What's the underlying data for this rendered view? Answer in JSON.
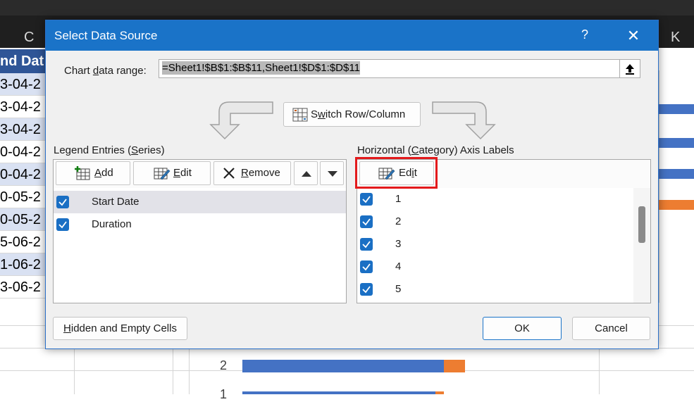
{
  "background": {
    "column_letters": [
      "C",
      "K"
    ],
    "column_header": "nd Dat",
    "column_cells": [
      "3-04-2",
      "3-04-2",
      "3-04-2",
      "0-04-2",
      "0-04-2",
      "0-05-2",
      "0-05-2",
      "5-06-2",
      "1-06-2",
      "3-06-2"
    ],
    "chart_axis_labels": [
      "2",
      "1"
    ],
    "colors": {
      "bar_blue": "#4472c4",
      "bar_orange": "#ed7d31",
      "header_blue": "#2f5597"
    }
  },
  "dialog": {
    "title": "Select Data Source",
    "help": "?",
    "close": "✕",
    "chart_range_label_pre": "Chart ",
    "chart_range_label_u": "d",
    "chart_range_label_post": "ata range:",
    "chart_range_value": "=Sheet1!$B$1:$B$11,Sheet1!$D$1:$D$11",
    "switch_pre": "S",
    "switch_u": "w",
    "switch_post": "itch Row/Column",
    "legend": {
      "title_pre": "Legend Entries (",
      "title_u": "S",
      "title_post": "eries)",
      "add_u": "A",
      "add_post": "dd",
      "edit_u": "E",
      "edit_post": "dit",
      "remove_u": "R",
      "remove_post": "emove",
      "items": [
        "Start Date",
        "Duration"
      ]
    },
    "axis": {
      "title_pre": "Horizontal (",
      "title_u": "C",
      "title_post": "ategory) Axis Labels",
      "edit_pre": "Ed",
      "edit_u": "i",
      "edit_post": "t",
      "items": [
        "1",
        "2",
        "3",
        "4",
        "5"
      ]
    },
    "hidden_u": "H",
    "hidden_post": "idden and Empty Cells",
    "ok": "OK",
    "cancel": "Cancel"
  }
}
